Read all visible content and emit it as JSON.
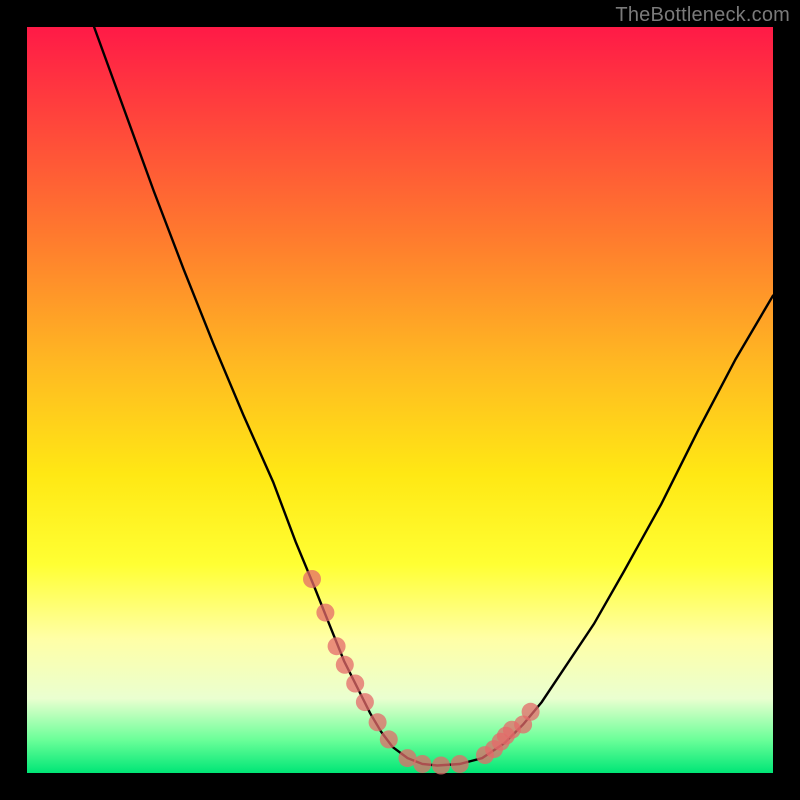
{
  "watermark_text": "TheBottleneck.com",
  "chart_data": {
    "type": "line",
    "title": "",
    "xlabel": "",
    "ylabel": "",
    "xlim": [
      0,
      100
    ],
    "ylim": [
      0,
      100
    ],
    "background_gradient": {
      "top": "#ff1a47",
      "bottom": "#00e676",
      "note": "vertical red→orange→yellow→green gradient"
    },
    "series": [
      {
        "name": "bottleneck-curve",
        "type": "line",
        "x": [
          9,
          13,
          17,
          21,
          25,
          29,
          33,
          36,
          38.5,
          40.5,
          42.5,
          44.5,
          46,
          47.5,
          49,
          51,
          53,
          55,
          58,
          61,
          64,
          66.5,
          69,
          72,
          76,
          80,
          85,
          90,
          95,
          100
        ],
        "y": [
          100,
          89,
          78,
          67.5,
          57.5,
          48,
          39,
          31,
          25,
          20,
          15,
          11,
          8,
          5.5,
          3.5,
          2,
          1.2,
          1,
          1.2,
          2,
          4,
          6.5,
          9.5,
          14,
          20,
          27,
          36,
          46,
          55.5,
          64
        ],
        "color": "#000000",
        "note": "V-shaped curve, minimum ~0.99 at x≈55"
      },
      {
        "name": "highlight-markers",
        "type": "scatter",
        "x": [
          38.2,
          40.0,
          41.5,
          42.6,
          44.0,
          45.3,
          47.0,
          48.5,
          51.0,
          53.0,
          55.5,
          58.0,
          61.4,
          62.6,
          63.5,
          64.2,
          65.0,
          66.5,
          67.5
        ],
        "y": [
          26.0,
          21.5,
          17.0,
          14.5,
          12.0,
          9.5,
          6.8,
          4.5,
          2.0,
          1.2,
          1.0,
          1.2,
          2.4,
          3.2,
          4.2,
          5.0,
          5.8,
          6.5,
          8.2
        ],
        "color": "#e46a6a",
        "marker_radius": 9
      }
    ]
  }
}
